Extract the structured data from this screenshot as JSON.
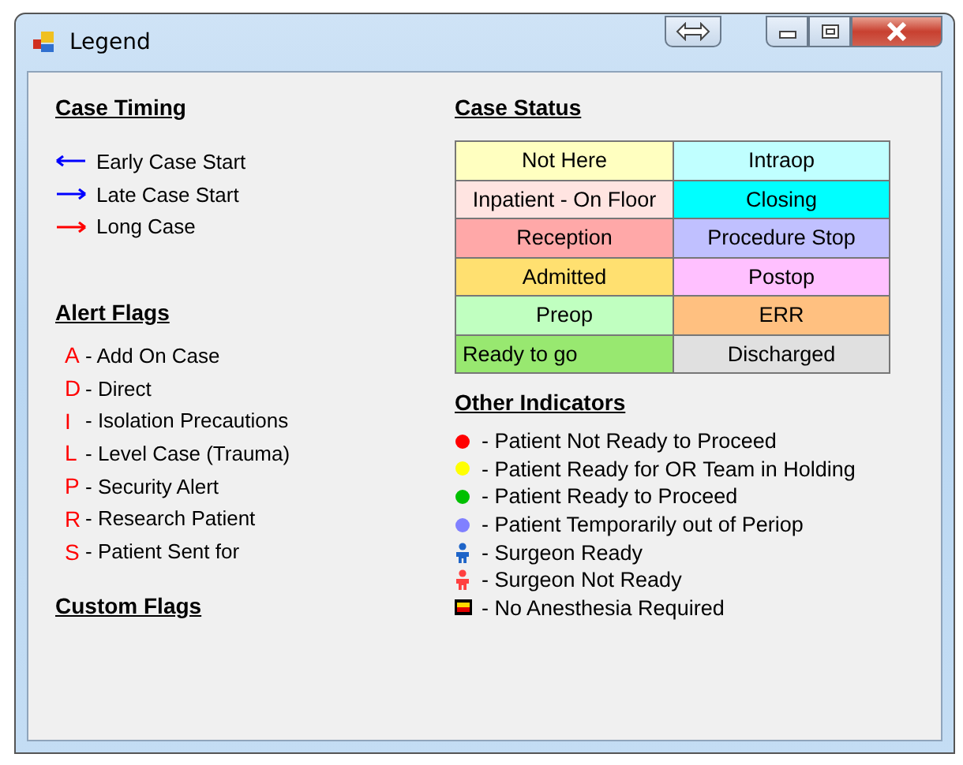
{
  "window": {
    "title": "Legend"
  },
  "case_timing": {
    "title": "Case Timing",
    "items": [
      {
        "label": "Early Case Start",
        "kind": "left",
        "color": "#0000ff"
      },
      {
        "label": "Late Case Start",
        "kind": "right",
        "color": "#0000ff"
      },
      {
        "label": "Long Case",
        "kind": "right",
        "color": "#ff0000"
      }
    ]
  },
  "alert_flags": {
    "title": "Alert Flags",
    "items": [
      {
        "letter": "A",
        "label": "- Add On Case"
      },
      {
        "letter": "D",
        "label": "- Direct"
      },
      {
        "letter": "I",
        "label": "- Isolation Precautions"
      },
      {
        "letter": "L",
        "label": "- Level Case (Trauma)"
      },
      {
        "letter": "P",
        "label": "- Security Alert"
      },
      {
        "letter": "R",
        "label": "- Research Patient"
      },
      {
        "letter": "S",
        "label": "- Patient Sent for"
      }
    ]
  },
  "custom_flags": {
    "title": "Custom Flags"
  },
  "case_status": {
    "title": "Case Status",
    "cells": [
      {
        "label": "Not Here",
        "color": "#ffffc0"
      },
      {
        "label": "Intraop",
        "color": "#c0ffff"
      },
      {
        "label": "Inpatient - On Floor",
        "color": "#ffe4e1"
      },
      {
        "label": "Closing",
        "color": "#00ffff"
      },
      {
        "label": "Reception",
        "color": "#ffa8a8"
      },
      {
        "label": "Procedure Stop",
        "color": "#c0c0ff"
      },
      {
        "label": "Admitted",
        "color": "#ffe070"
      },
      {
        "label": "Postop",
        "color": "#ffc0ff"
      },
      {
        "label": "Preop",
        "color": "#c0ffc0"
      },
      {
        "label": "ERR",
        "color": "#ffc080"
      },
      {
        "label": "Ready to go",
        "color": "#98e870",
        "left_aligned": true
      },
      {
        "label": "Discharged",
        "color": "#e0e0e0"
      }
    ]
  },
  "other_indicators": {
    "title": "Other Indicators",
    "items": [
      {
        "kind": "dot",
        "color": "#ff0000",
        "label": "- Patient Not Ready to Proceed"
      },
      {
        "kind": "dot",
        "color": "#ffff00",
        "label": "- Patient Ready for OR Team in Holding"
      },
      {
        "kind": "dot",
        "color": "#00c000",
        "label": "- Patient Ready to Proceed"
      },
      {
        "kind": "dot",
        "color": "#8080ff",
        "label": "- Patient Temporarily out of Periop"
      },
      {
        "kind": "person",
        "color": "#1e64c8",
        "label": "- Surgeon Ready"
      },
      {
        "kind": "person",
        "color": "#ff4040",
        "label": "- Surgeon Not Ready"
      },
      {
        "kind": "box",
        "color": "#ffd700",
        "label": "- No Anesthesia Required"
      }
    ]
  }
}
